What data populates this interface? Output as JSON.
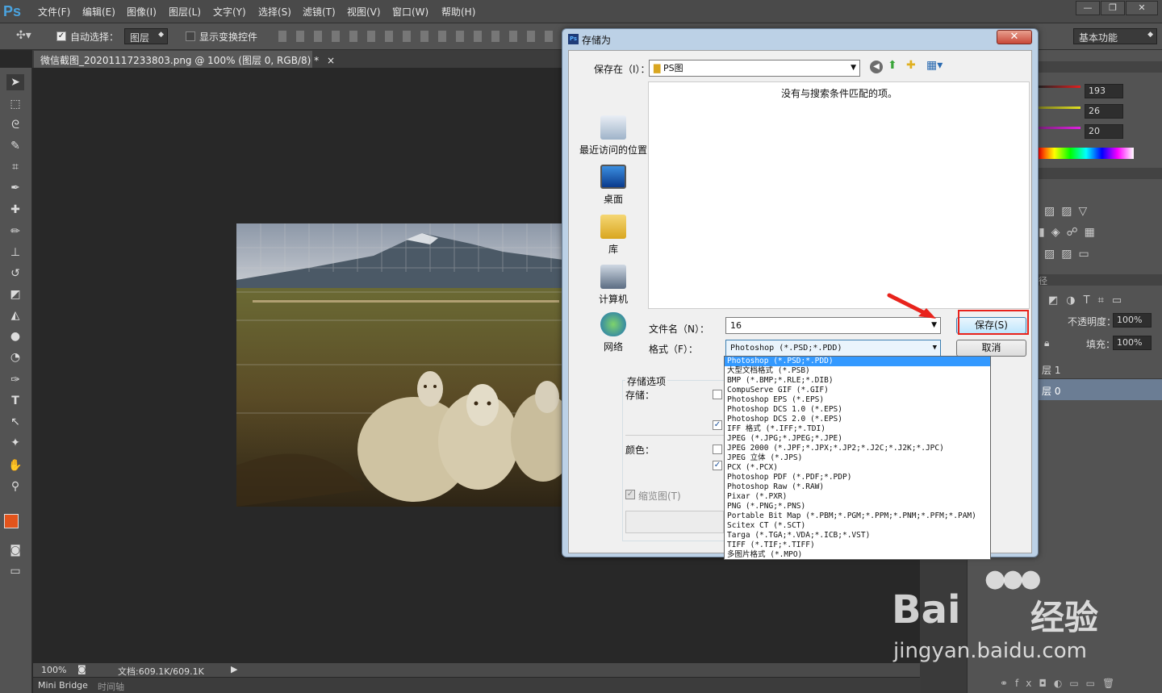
{
  "app": {
    "logo": "Ps",
    "workspace": "基本功能"
  },
  "menu": [
    "文件(F)",
    "编辑(E)",
    "图像(I)",
    "图层(L)",
    "文字(Y)",
    "选择(S)",
    "滤镜(T)",
    "视图(V)",
    "窗口(W)",
    "帮助(H)"
  ],
  "window_buttons": [
    "—",
    "❐",
    "✕"
  ],
  "options": {
    "auto_select_label": "自动选择：",
    "auto_select_value": "图层",
    "show_transform_label": "显示变换控件"
  },
  "document": {
    "tab_title": "微信截图_20201117233803.png @ 100% (图层 0, RGB/8) *",
    "tab_close": "×"
  },
  "status": {
    "zoom": "100%",
    "doc_info": "文档:609.1K/609.1K"
  },
  "bottom_tabs": [
    "Mini Bridge",
    "时间轴"
  ],
  "color_panel": {
    "r": "193",
    "g": "26",
    "b": "20"
  },
  "layers_panel": {
    "opacity_label": "不透明度：",
    "opacity_value": "100%",
    "fill_label": "填充：",
    "fill_value": "100%",
    "layer_top": "层 1",
    "layer_bottom": "层 0",
    "tab_partial": "径"
  },
  "dialog": {
    "title": "存储为",
    "close": "✕",
    "save_in_label": "保存在（I）：",
    "save_in_value": "PS图",
    "empty_message": "没有与搜索条件匹配的项。",
    "places": [
      "最近访问的位置",
      "桌面",
      "库",
      "计算机",
      "网络"
    ],
    "filename_label": "文件名（N）：",
    "filename_value": "16",
    "format_label": "格式（F）：",
    "format_value": "Photoshop (*.PSD;*.PDD)",
    "save_button": "保存(S)",
    "cancel_button": "取消",
    "storage_options_title": "存储选项",
    "storage_label": "存储：",
    "color_label": "颜色：",
    "thumbnail_label": "缩览图(T)",
    "format_options": [
      "Photoshop (*.PSD;*.PDD)",
      "大型文档格式 (*.PSB)",
      "BMP (*.BMP;*.RLE;*.DIB)",
      "CompuServe GIF (*.GIF)",
      "Photoshop EPS (*.EPS)",
      "Photoshop DCS 1.0 (*.EPS)",
      "Photoshop DCS 2.0 (*.EPS)",
      "IFF 格式 (*.IFF;*.TDI)",
      "JPEG (*.JPG;*.JPEG;*.JPE)",
      "JPEG 2000 (*.JPF;*.JPX;*.JP2;*.J2C;*.J2K;*.JPC)",
      "JPEG 立体 (*.JPS)",
      "PCX (*.PCX)",
      "Photoshop PDF (*.PDF;*.PDP)",
      "Photoshop Raw (*.RAW)",
      "Pixar (*.PXR)",
      "PNG (*.PNG;*.PNS)",
      "Portable Bit Map (*.PBM;*.PGM;*.PPM;*.PNM;*.PFM;*.PAM)",
      "Scitex CT (*.SCT)",
      "Targa (*.TGA;*.VDA;*.ICB;*.VST)",
      "TIFF (*.TIF;*.TIFF)",
      "多图片格式 (*.MPO)"
    ]
  },
  "watermark": {
    "brand": "Bai",
    "brand_cn": "经验",
    "url": "jingyan.baidu.com"
  },
  "colors": {
    "accent_red": "#e8231c",
    "selection_blue": "#3399ff",
    "fg_swatch": "#e3541c",
    "bg_swatch": "#c81e14"
  }
}
